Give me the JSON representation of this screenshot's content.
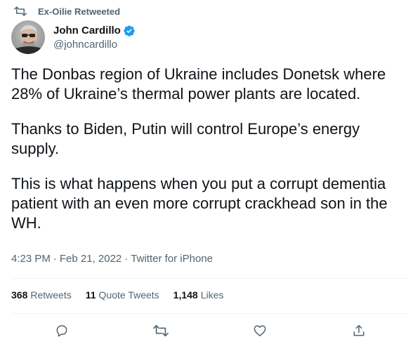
{
  "retweet": {
    "icon": "retweet-icon",
    "label": "Ex-Oilie Retweeted"
  },
  "author": {
    "display_name": "John Cardillo",
    "handle": "@johncardillo",
    "verified_icon": "verified-badge-icon",
    "verified_color": "#1d9bf0"
  },
  "tweet": {
    "paragraphs": [
      "The Donbas region of Ukraine includes Donetsk where 28% of Ukraine’s thermal power plants are located.",
      "Thanks to Biden, Putin will control Europe’s energy supply.",
      "This is what happens when you put a corrupt dementia patient with an even more corrupt crackhead son in the WH."
    ]
  },
  "meta": {
    "time": "4:23 PM",
    "date": "Feb 21, 2022",
    "source": "Twitter for iPhone",
    "separator": "·"
  },
  "stats": {
    "retweets": {
      "count": "368",
      "label": "Retweets"
    },
    "quote_tweets": {
      "count": "11",
      "label": "Quote Tweets"
    },
    "likes": {
      "count": "1,148",
      "label": "Likes"
    }
  },
  "actions": [
    {
      "name": "reply",
      "icon": "reply-icon"
    },
    {
      "name": "retweet",
      "icon": "retweet-icon"
    },
    {
      "name": "like",
      "icon": "heart-icon"
    },
    {
      "name": "share",
      "icon": "share-icon"
    }
  ],
  "colors": {
    "text_primary": "#0f1419",
    "text_secondary": "#536471",
    "divider": "#eff3f4",
    "accent": "#1d9bf0"
  }
}
